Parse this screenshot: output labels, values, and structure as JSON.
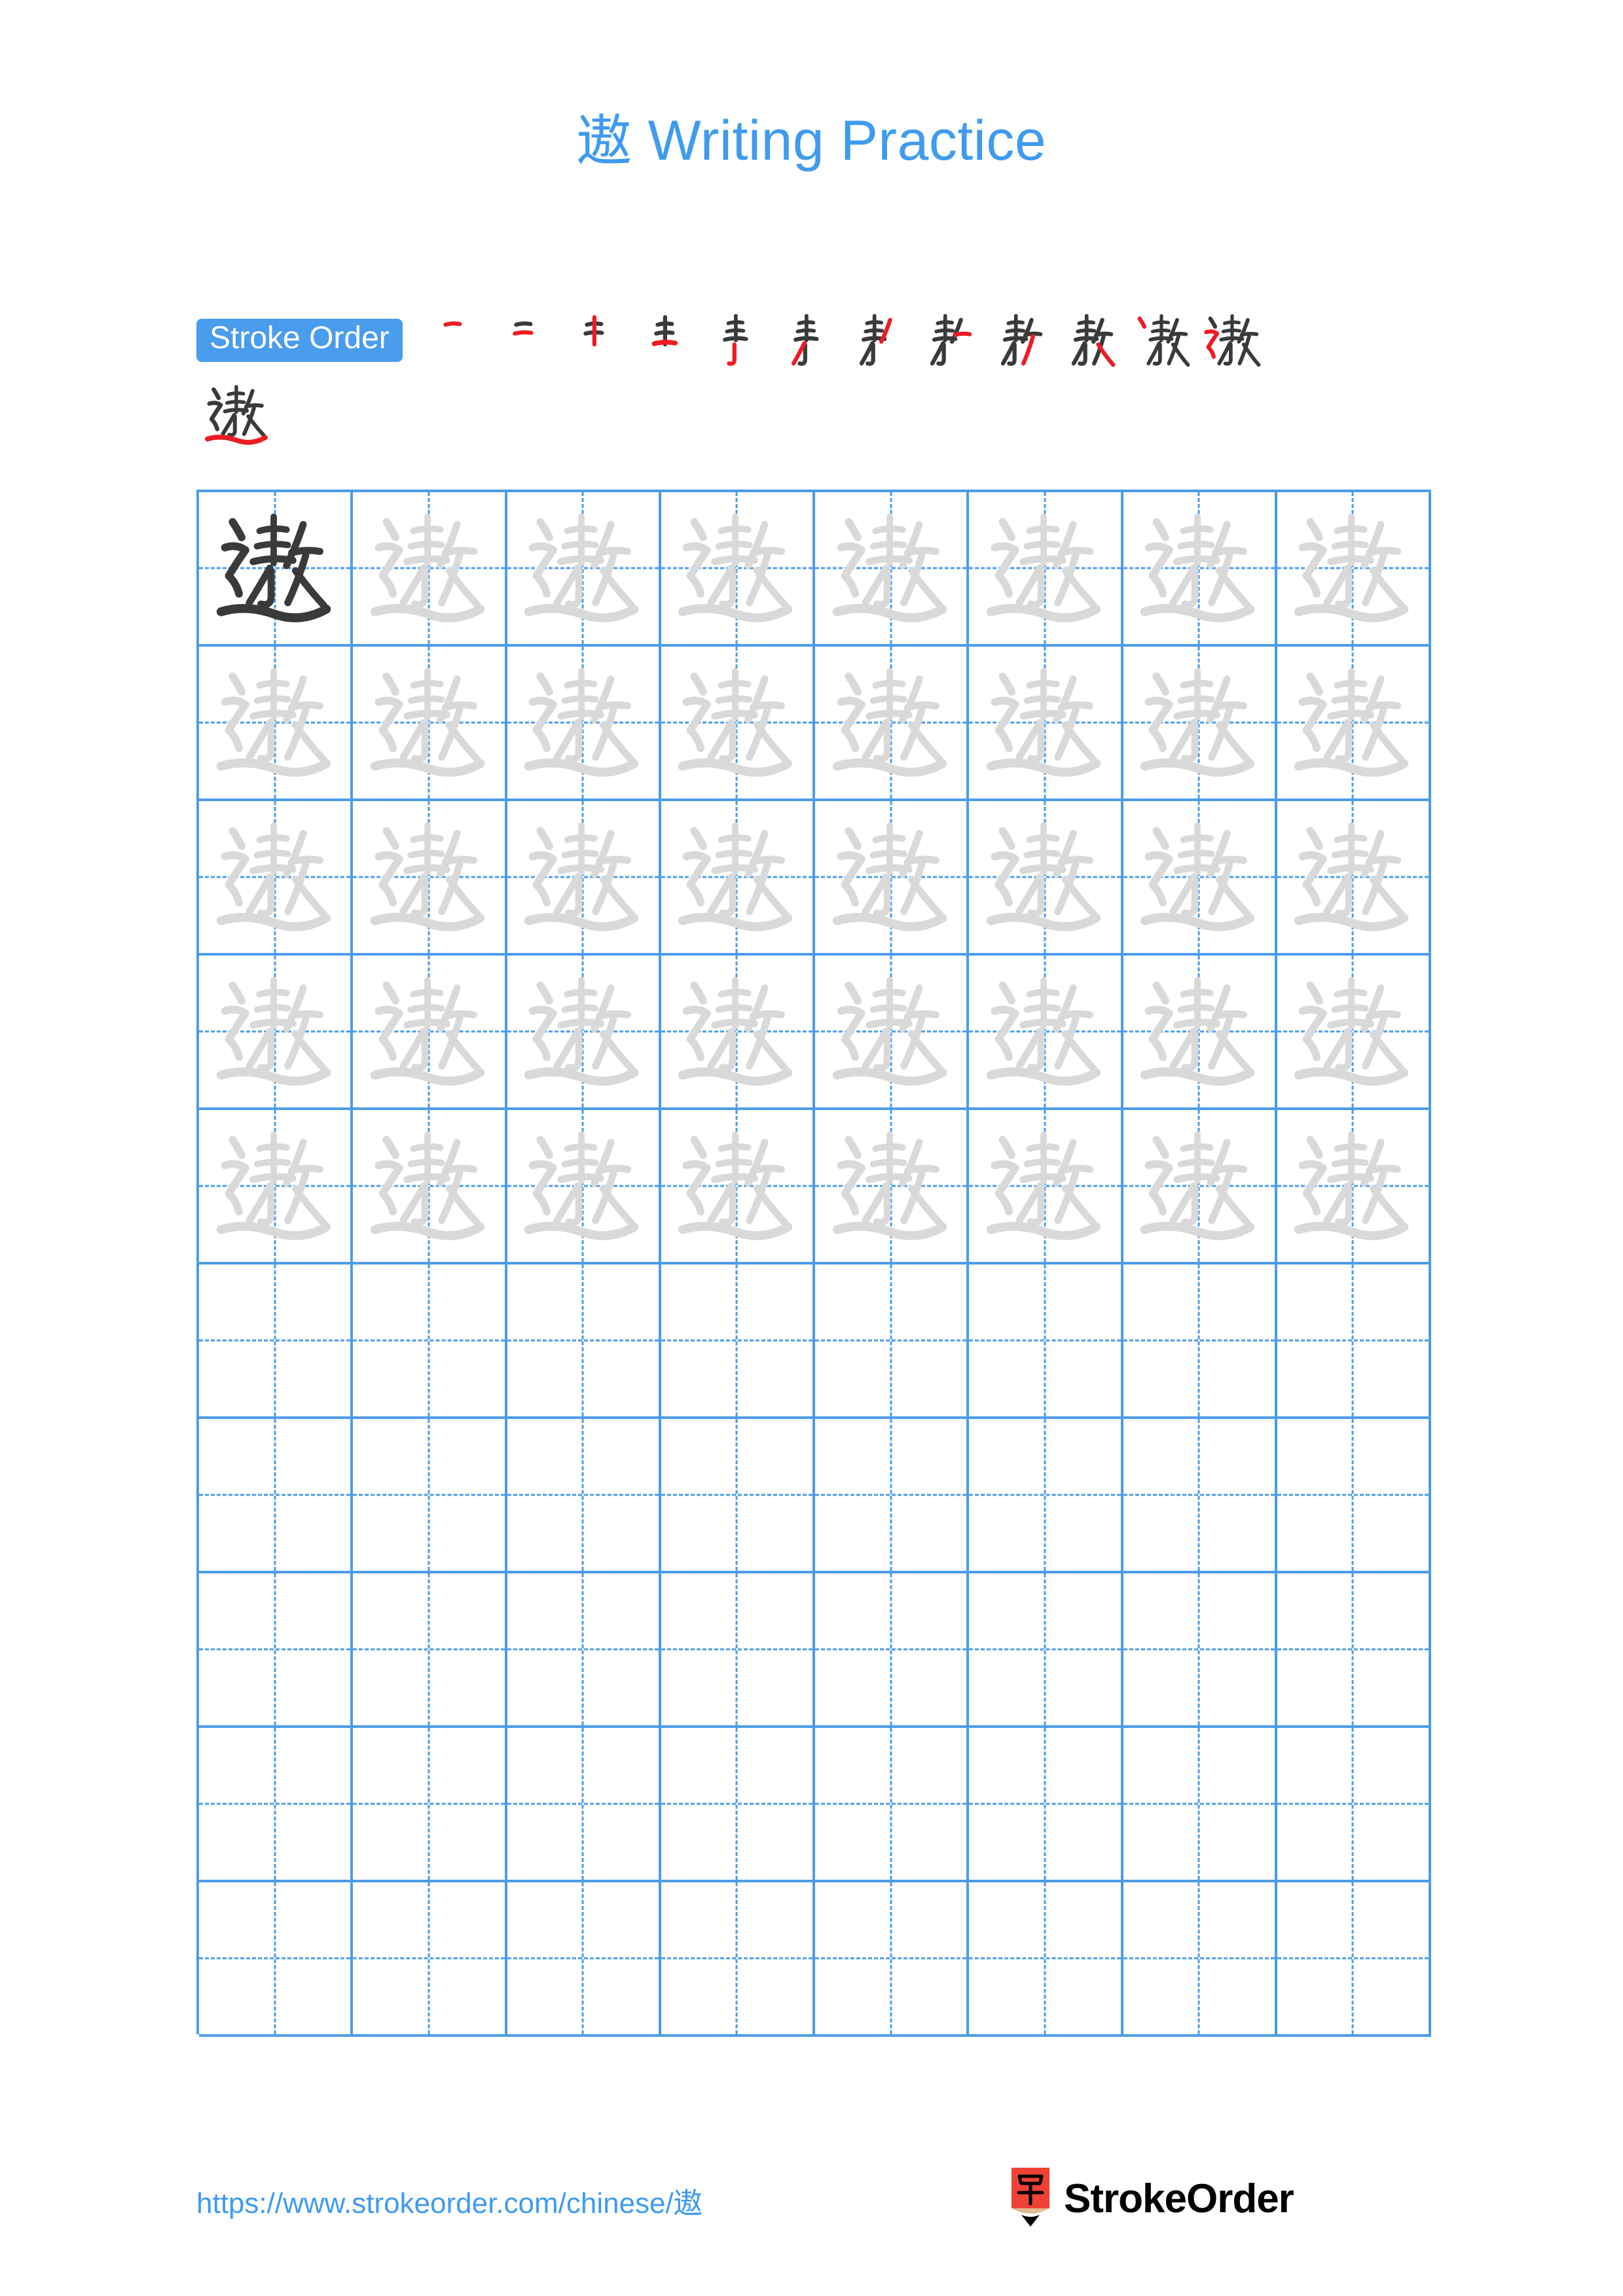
{
  "character": "遨",
  "title": {
    "han": "遨",
    "suffix": " Writing Practice",
    "color": "#3f9bee"
  },
  "stroke_order": {
    "label": "Stroke Order",
    "badge_color": "#4a9ced",
    "badge_text_color": "#ffffff",
    "total_strokes": 13,
    "prev_stroke_color": "#3a3a3a",
    "new_stroke_color": "#ed1c24",
    "steps": [
      {
        "index": 1,
        "new_stroke": "heng (横)"
      },
      {
        "index": 2,
        "new_stroke": "heng (横)"
      },
      {
        "index": 3,
        "new_stroke": "shu (竖)"
      },
      {
        "index": 4,
        "new_stroke": "heng (横)"
      },
      {
        "index": 5,
        "new_stroke": "shu-gou (竖钩)"
      },
      {
        "index": 6,
        "new_stroke": "pie (撇)"
      },
      {
        "index": 7,
        "new_stroke": "pie (撇)"
      },
      {
        "index": 8,
        "new_stroke": "heng-pie (横撇)"
      },
      {
        "index": 9,
        "new_stroke": "pie (撇)"
      },
      {
        "index": 10,
        "new_stroke": "na (捺)"
      },
      {
        "index": 11,
        "new_stroke": "dian (点)"
      },
      {
        "index": 12,
        "new_stroke": "heng-zhe-zhe-pie (横折折撇)"
      },
      {
        "index": 13,
        "new_stroke": "ping-na (平捺)"
      }
    ]
  },
  "practice_grid": {
    "columns": 8,
    "rows": 10,
    "line_color": "#4d9ce8",
    "model_char_color": "#3a3a3a",
    "trace_char_color": "#d9d9d9",
    "filled_rows": 5,
    "empty_rows": 5,
    "model_cell": {
      "row": 1,
      "col": 1
    }
  },
  "footer": {
    "url": "https://www.strokeorder.com/chinese/遨",
    "url_color": "#3f9bee",
    "brand_name": "StrokeOrder",
    "brand_mark_char": "字",
    "brand_mark_color": "#ef4136",
    "brand_mark_wood_color": "#dfbb8e",
    "brand_mark_tip_color": "#000000"
  }
}
